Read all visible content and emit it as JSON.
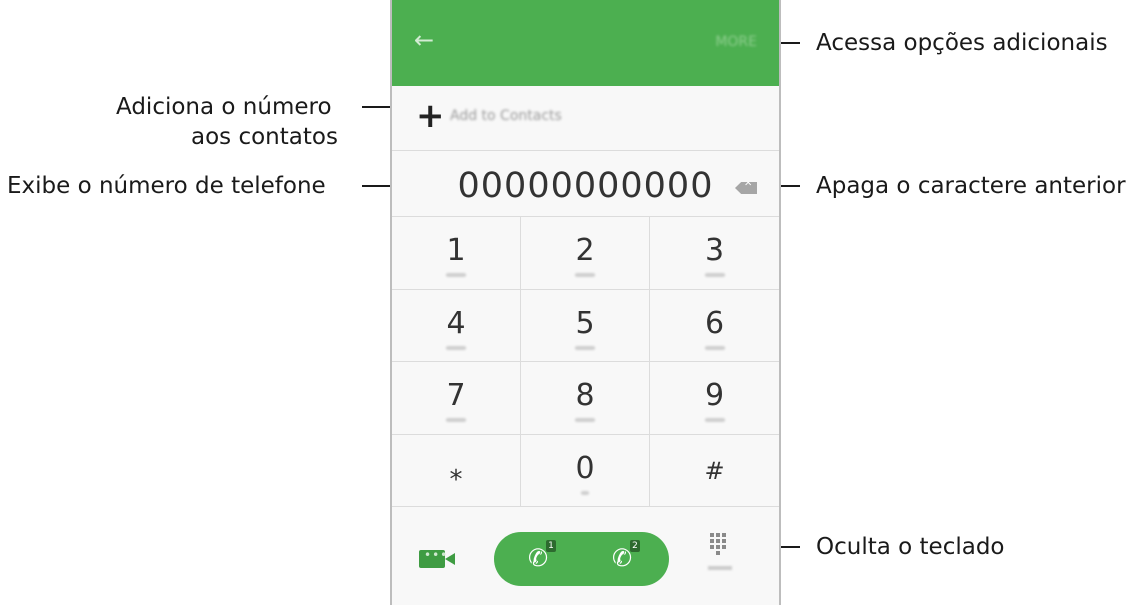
{
  "callouts": {
    "more_options": "Acessa opções adicionais",
    "add_contact_line1": "Adiciona o número",
    "add_contact_line2": "aos contatos",
    "show_number": "Exibe o número de telefone",
    "backspace": "Apaga o caractere anterior",
    "hide_keypad": "Oculta o teclado"
  },
  "phone": {
    "header": {
      "back_icon": "arrow-left-icon",
      "more_label": "MORE"
    },
    "add_to_contacts": {
      "icon": "plus-icon",
      "label": "Add to Contacts"
    },
    "number_display": "00000000000",
    "keys": [
      {
        "digit": "1"
      },
      {
        "digit": "2"
      },
      {
        "digit": "3"
      },
      {
        "digit": "4"
      },
      {
        "digit": "5"
      },
      {
        "digit": "6"
      },
      {
        "digit": "7"
      },
      {
        "digit": "8"
      },
      {
        "digit": "9"
      },
      {
        "digit": "⁎"
      },
      {
        "digit": "0"
      },
      {
        "digit": "#"
      }
    ],
    "bottom": {
      "video_icon": "video-call-icon",
      "call_icon": "phone-icon",
      "sim1": "1",
      "sim2": "2",
      "hide_icon": "keypad-grid-icon"
    }
  },
  "colors": {
    "accent": "#4caf50",
    "dark_accent": "#3f9c43"
  }
}
